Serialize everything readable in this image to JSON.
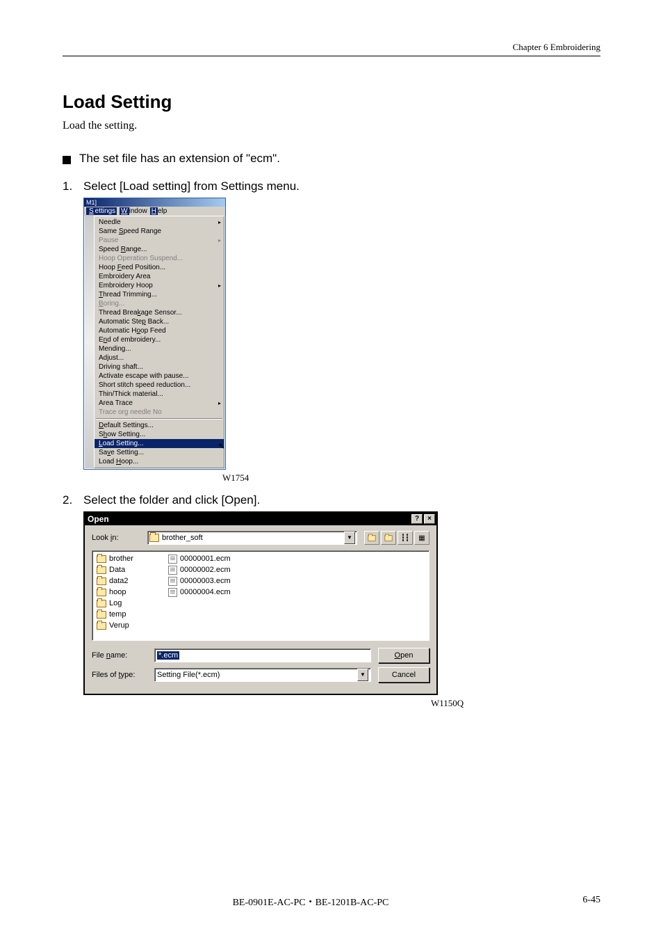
{
  "chapter_header": "Chapter 6   Embroidering",
  "section_title": "Load Setting",
  "section_desc": "Load the setting.",
  "bullet1": "The set file has an extension of \"ecm\".",
  "step1": {
    "num": "1.",
    "text": "Select [Load setting] from Settings menu."
  },
  "step2": {
    "num": "2.",
    "text": "Select the folder and click [Open]."
  },
  "menu": {
    "title": "M1]",
    "menubar": {
      "settings": "Settings",
      "window": "Window",
      "help": "Help"
    },
    "items": {
      "needle": "Needle",
      "same_speed": "Same Speed Range",
      "pause": "Pause",
      "speed_range": "Speed Range...",
      "hoop_op_suspend": "Hoop Operation Suspend...",
      "hoop_feed_pos": "Hoop Feed Position...",
      "emb_area": "Embroidery Area",
      "emb_hoop": "Embroidery Hoop",
      "thread_trim": "Thread Trimming...",
      "boring": "Boring...",
      "tb_sensor": "Thread Breakage Sensor...",
      "auto_step_back": "Automatic Step Back...",
      "auto_hoop_feed": "Automatic Hoop Feed",
      "end_emb": "End of embroidery...",
      "mending": "Mending...",
      "adjust": "Adjust...",
      "driving_shaft": "Driving shaft...",
      "activate_escape": "Activate escape with pause...",
      "short_stitch": "Short stitch speed reduction...",
      "thin_thick": "Thin/Thick material...",
      "area_trace": "Area Trace",
      "trace_org": "Trace org needle No",
      "default_settings": "Default Settings...",
      "show_setting": "Show Setting...",
      "load_setting": "Load Setting...",
      "save_setting": "Save Setting...",
      "load_hoop": "Load Hoop..."
    }
  },
  "fig1_label": "W1754",
  "dialog": {
    "title": "Open",
    "lookin_label": "Look in:",
    "lookin_value": "brother_soft",
    "folders": [
      "brother",
      "Data",
      "data2",
      "hoop",
      "Log",
      "temp",
      "Verup"
    ],
    "files": [
      "00000001.ecm",
      "00000002.ecm",
      "00000003.ecm",
      "00000004.ecm"
    ],
    "filename_label": "File name:",
    "filename_value": "*.ecm",
    "filetype_label": "Files of type:",
    "filetype_value": "Setting File(*.ecm)",
    "open_btn": "Open",
    "cancel_btn": "Cancel"
  },
  "fig2_label": "W1150Q",
  "footer_center": "BE-0901E-AC-PC・BE-1201B-AC-PC",
  "footer_right": "6-45"
}
